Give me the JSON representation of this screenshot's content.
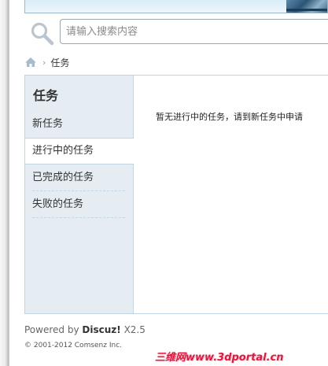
{
  "search": {
    "placeholder": "请输入搜索内容"
  },
  "breadcrumb": {
    "home_icon": "home-icon",
    "separator": "›",
    "current": "任务"
  },
  "sidebar": {
    "title": "任务",
    "items": [
      {
        "label": "新任务",
        "active": false
      },
      {
        "label": "进行中的任务",
        "active": true
      },
      {
        "label": "已完成的任务",
        "active": false
      },
      {
        "label": "失败的任务",
        "active": false
      }
    ]
  },
  "content": {
    "message": "暂无进行中的任务，请到新任务中申请"
  },
  "footer": {
    "powered_prefix": "Powered by",
    "powered_brand": "Discuz!",
    "powered_version": "X2.5",
    "copyright": "© 2001-2012 Comsenz Inc.",
    "watermark": "三维网www.3dportal.cn"
  },
  "colors": {
    "sidebar_bg": "#e5edf2",
    "border": "#c2d5e3",
    "watermark": "#e8143c"
  }
}
